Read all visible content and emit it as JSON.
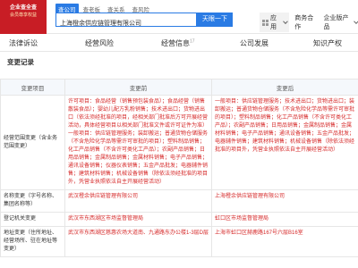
{
  "promo": {
    "line1": "企业查全查",
    "line2": "会员尊享权益"
  },
  "search": {
    "tabs": [
      "查公司",
      "查老板",
      "查关系",
      "查风险"
    ],
    "value": "上海橙余供应链管理有限公司",
    "button": "天眼一下"
  },
  "nav": {
    "app": "应用",
    "vip": "商务合作",
    "enterprise": "企业版产品"
  },
  "dimensions": [
    {
      "label": "法律诉讼"
    },
    {
      "label": "经营风险"
    },
    {
      "label": "经营信息",
      "count": "17"
    },
    {
      "label": "公司发展"
    },
    {
      "label": "知识产权"
    }
  ],
  "section_title": "变更记录",
  "table": {
    "headers": [
      "变更项目",
      "变更前",
      "变更后"
    ],
    "rows": [
      {
        "item": "经营范围变更（含业务范围变更）",
        "before": "许可项目：食品经营（销售预包装食品）；食品经营（销售散装食品）；婴幼儿配方乳粉销售；技术进出口；货物进出口（依法须经批准的项目，经相关部门批准后方可开展经营活动，具体经营项目以相关部门批准文件或许可证件为准）一般项目：供应链管理服务；装卸搬运；普通货物仓储服务（不含危险化学品等需许可审批的项目）；塑料制品销售；化工产品销售（不含许可类化工产品）；农副产品销售；日用品销售；金属制品销售；金属材料销售；电子产品销售；通讯设备销售；仪器仪表销售；五金产品批发；电器辅件销售；建筑材料销售；机械设备销售（除依法须经批准的项目外，凭营业执照依法自主开展经营活动）",
        "after": "一般项目：供应链管理服务；技术进出口；货物进出口；装卸搬运；普通货物仓储服务（不含危险化学品等需许可审批的项目）；塑料制品销售；化工产品销售（不含许可类化工产品）；农副产品销售；日用品销售；金属制品销售；金属材料销售；电子产品销售；通讯设备销售；五金产品批发；电器辅件销售；建筑材料销售；机械设备销售（除依法须经批准的项目外，凭营业执照依法自主开展经营活动）"
      },
      {
        "item": "名称变更（字号名称、集团名称等）",
        "before": "武汉橙余供应链管理有限公司",
        "after": "上海橙余供应链管理有限公司"
      },
      {
        "item": "登记机关变更",
        "before": "武汉市东西湖区市场监督管理局",
        "after": "虹口区市场监督管理局"
      },
      {
        "item": "地址变更（住所地址、经营场所、驻在地址等变更）",
        "before": "武汉市东西湖区慈惠农场大道南、九通路东办公楼1-3层D层",
        "after": "上海市虹口区赫鹿路167号六层B16室"
      }
    ]
  },
  "colors": {
    "brand": "#2a7be4",
    "promo": "#c81d25",
    "highlight": "#d62b2b"
  }
}
